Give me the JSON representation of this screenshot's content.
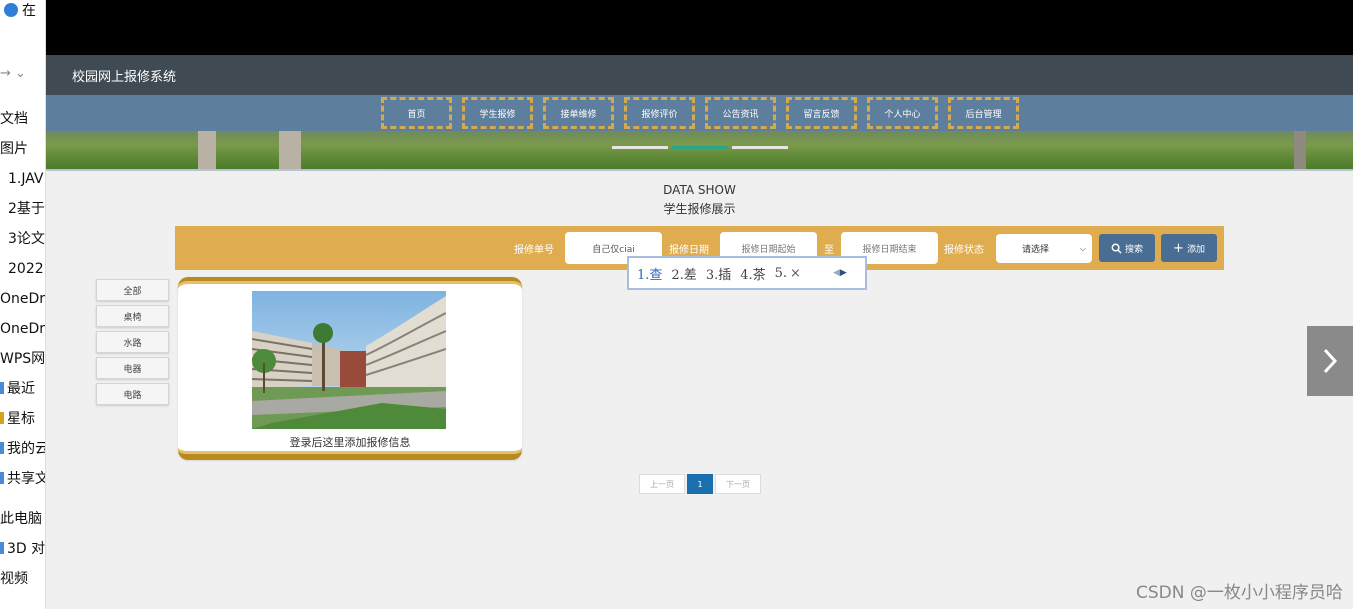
{
  "explorer": {
    "top_item": "在",
    "arrows": "→   ⌄",
    "items": [
      "文档",
      "图片",
      "1.JAV",
      "2基于",
      "3论文",
      "2022",
      "OneDr",
      "OneDr",
      "WPS网",
      "最近",
      "星标",
      "我的云",
      "共享文",
      "",
      "此电脑",
      "3D 对",
      "视频"
    ]
  },
  "app": {
    "title": "校园网上报修系统",
    "nav": [
      "首页",
      "学生报修",
      "接单维修",
      "报修评价",
      "公告资讯",
      "留言反馈",
      "个人中心",
      "后台管理"
    ],
    "heading_en": "DATA SHOW",
    "heading_cn": "学生报修展示",
    "search": {
      "order_label": "报修单号",
      "order_value": "自己仅ciai",
      "date_label": "报修日期",
      "date_start_placeholder": "报修日期起始",
      "to_label": "至",
      "date_end_placeholder": "报修日期结束",
      "status_label": "报修状态",
      "status_value": "请选择",
      "search_button": "搜索",
      "add_button": "添加"
    },
    "ime": {
      "candidates": [
        "1.查",
        "2.差",
        "3.插",
        "4.茶",
        "5."
      ],
      "close": "×"
    },
    "categories": [
      "全部",
      "桌椅",
      "水路",
      "电器",
      "电路"
    ],
    "card": {
      "caption": "登录后这里添加报修信息"
    },
    "pager": {
      "prev": "上一页",
      "current": "1",
      "next": "下一页"
    }
  },
  "watermark": "CSDN @一枚小小程序员哈",
  "colors": {
    "accent": "#dfac50",
    "nav_border": "#d4a94f",
    "button": "#4a6d94",
    "pager_active": "#1a6fae"
  }
}
